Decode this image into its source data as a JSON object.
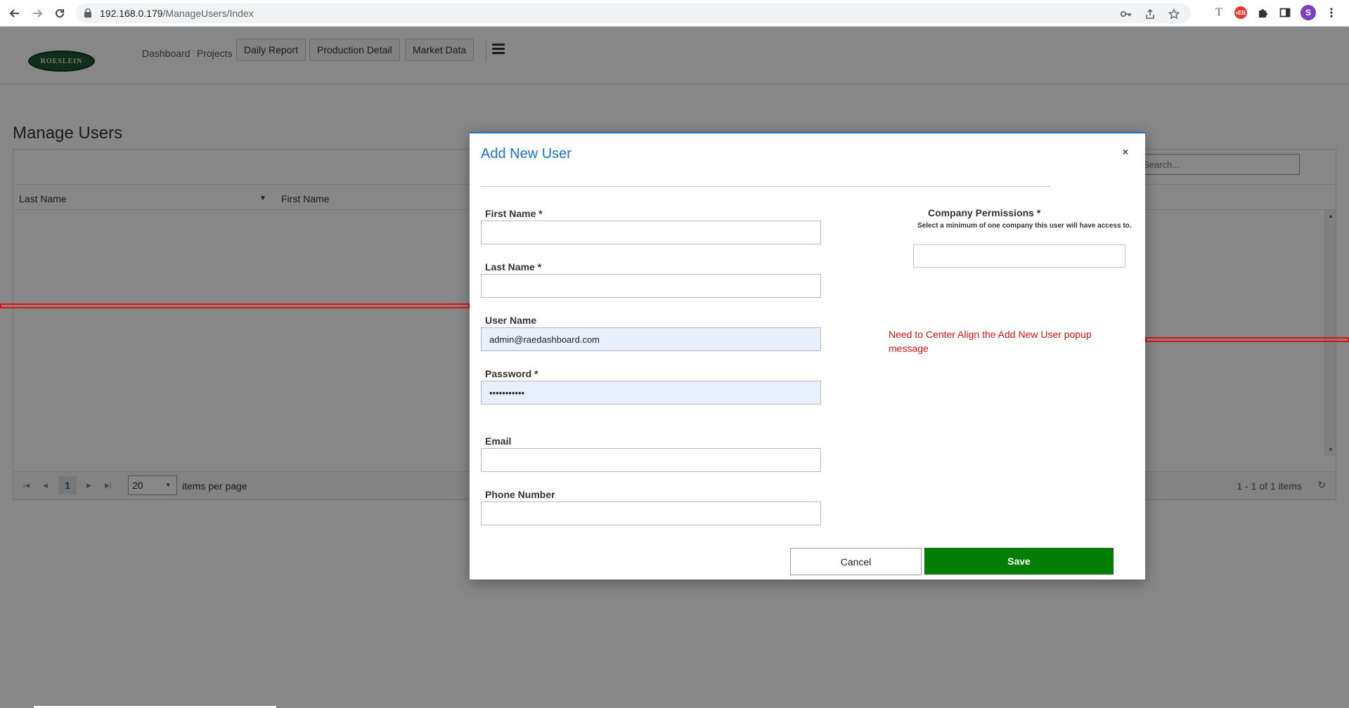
{
  "browser": {
    "url_host": "192.168.0.179",
    "url_path": "/ManageUsers/Index",
    "avatar_letter": "S",
    "ext_badge": "•EB"
  },
  "header": {
    "logo_text": "ROESLEIN",
    "nav_links": [
      "Dashboard",
      "Projects"
    ],
    "nav_buttons": [
      "Daily Report",
      "Production Detail",
      "Market Data"
    ]
  },
  "page": {
    "title": "Manage Users",
    "search_placeholder": "Search...",
    "columns": [
      "Last Name",
      "First Name"
    ],
    "pager": {
      "current_page": "1",
      "page_size": "20",
      "items_label": "items per page",
      "info": "1 - 1 of 1 items"
    }
  },
  "modal": {
    "title": "Add New User",
    "close_symbol": "×",
    "fields": {
      "first_name": {
        "label": "First Name *",
        "value": ""
      },
      "last_name": {
        "label": "Last Name *",
        "value": ""
      },
      "user_name": {
        "label": "User Name",
        "value": "admin@raedashboard.com"
      },
      "password": {
        "label": "Password *",
        "value": "•••••••••••"
      },
      "email": {
        "label": "Email",
        "value": ""
      },
      "phone": {
        "label": "Phone Number",
        "value": ""
      }
    },
    "permissions": {
      "title": "Company Permissions *",
      "subtitle": "Select a minimum of one company this user will have access to."
    },
    "note": "Need to Center Align the Add New User popup message",
    "cancel_label": "Cancel",
    "save_label": "Save"
  },
  "colors": {
    "accent_blue": "#1a73c9",
    "save_green": "#027f02",
    "annotation_red": "#e01010",
    "autofill_bg": "#e8f0fe"
  }
}
